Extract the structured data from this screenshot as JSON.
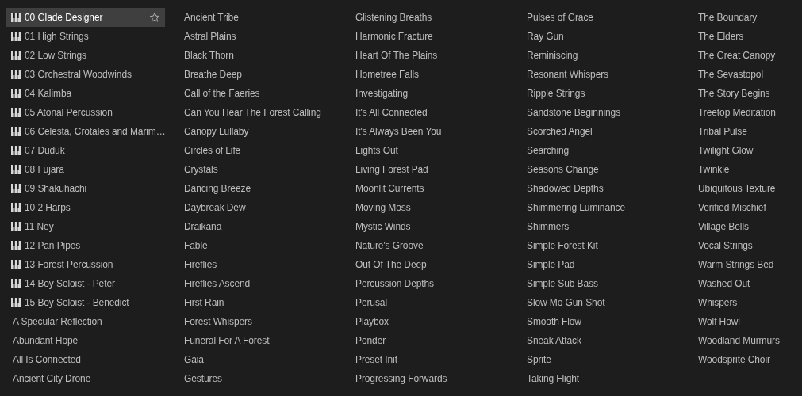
{
  "presets": [
    {
      "label": "00 Glade Designer",
      "kind": "instrument",
      "selected": true
    },
    {
      "label": "01 High Strings",
      "kind": "instrument",
      "selected": false
    },
    {
      "label": "02 Low Strings",
      "kind": "instrument",
      "selected": false
    },
    {
      "label": "03 Orchestral Woodwinds",
      "kind": "instrument",
      "selected": false
    },
    {
      "label": "04 Kalimba",
      "kind": "instrument",
      "selected": false
    },
    {
      "label": "05 Atonal Percussion",
      "kind": "instrument",
      "selected": false
    },
    {
      "label": "06 Celesta, Crotales and Marim…",
      "kind": "instrument",
      "selected": false
    },
    {
      "label": "07 Duduk",
      "kind": "instrument",
      "selected": false
    },
    {
      "label": "08 Fujara",
      "kind": "instrument",
      "selected": false
    },
    {
      "label": "09 Shakuhachi",
      "kind": "instrument",
      "selected": false
    },
    {
      "label": "10 2 Harps",
      "kind": "instrument",
      "selected": false
    },
    {
      "label": "11 Ney",
      "kind": "instrument",
      "selected": false
    },
    {
      "label": "12 Pan Pipes",
      "kind": "instrument",
      "selected": false
    },
    {
      "label": "13 Forest Percussion",
      "kind": "instrument",
      "selected": false
    },
    {
      "label": "14 Boy Soloist - Peter",
      "kind": "instrument",
      "selected": false
    },
    {
      "label": "15 Boy Soloist - Benedict",
      "kind": "instrument",
      "selected": false
    },
    {
      "label": "A Specular Reflection",
      "kind": "preset",
      "selected": false
    },
    {
      "label": "Abundant Hope",
      "kind": "preset",
      "selected": false
    },
    {
      "label": "All Is Connected",
      "kind": "preset",
      "selected": false
    },
    {
      "label": "Ancient City Drone",
      "kind": "preset",
      "selected": false
    },
    {
      "label": "Ancient Tribe",
      "kind": "preset",
      "selected": false
    },
    {
      "label": "Astral Plains",
      "kind": "preset",
      "selected": false
    },
    {
      "label": "Black Thorn",
      "kind": "preset",
      "selected": false
    },
    {
      "label": "Breathe Deep",
      "kind": "preset",
      "selected": false
    },
    {
      "label": "Call of the Faeries",
      "kind": "preset",
      "selected": false
    },
    {
      "label": "Can You Hear The Forest Calling",
      "kind": "preset",
      "selected": false
    },
    {
      "label": "Canopy Lullaby",
      "kind": "preset",
      "selected": false
    },
    {
      "label": "Circles of Life",
      "kind": "preset",
      "selected": false
    },
    {
      "label": "Crystals",
      "kind": "preset",
      "selected": false
    },
    {
      "label": "Dancing Breeze",
      "kind": "preset",
      "selected": false
    },
    {
      "label": "Daybreak Dew",
      "kind": "preset",
      "selected": false
    },
    {
      "label": "Draikana",
      "kind": "preset",
      "selected": false
    },
    {
      "label": "Fable",
      "kind": "preset",
      "selected": false
    },
    {
      "label": "Fireflies",
      "kind": "preset",
      "selected": false
    },
    {
      "label": "Fireflies Ascend",
      "kind": "preset",
      "selected": false
    },
    {
      "label": "First Rain",
      "kind": "preset",
      "selected": false
    },
    {
      "label": "Forest Whispers",
      "kind": "preset",
      "selected": false
    },
    {
      "label": "Funeral For A Forest",
      "kind": "preset",
      "selected": false
    },
    {
      "label": "Gaia",
      "kind": "preset",
      "selected": false
    },
    {
      "label": "Gestures",
      "kind": "preset",
      "selected": false
    },
    {
      "label": "Glistening Breaths",
      "kind": "preset",
      "selected": false
    },
    {
      "label": "Harmonic Fracture",
      "kind": "preset",
      "selected": false
    },
    {
      "label": "Heart Of The Plains",
      "kind": "preset",
      "selected": false
    },
    {
      "label": "Hometree Falls",
      "kind": "preset",
      "selected": false
    },
    {
      "label": "Investigating",
      "kind": "preset",
      "selected": false
    },
    {
      "label": "It's All Connected",
      "kind": "preset",
      "selected": false
    },
    {
      "label": "It's Always Been You",
      "kind": "preset",
      "selected": false
    },
    {
      "label": "Lights Out",
      "kind": "preset",
      "selected": false
    },
    {
      "label": "Living Forest Pad",
      "kind": "preset",
      "selected": false
    },
    {
      "label": "Moonlit Currents",
      "kind": "preset",
      "selected": false
    },
    {
      "label": "Moving Moss",
      "kind": "preset",
      "selected": false
    },
    {
      "label": "Mystic Winds",
      "kind": "preset",
      "selected": false
    },
    {
      "label": "Nature's Groove",
      "kind": "preset",
      "selected": false
    },
    {
      "label": "Out Of The Deep",
      "kind": "preset",
      "selected": false
    },
    {
      "label": "Percussion Depths",
      "kind": "preset",
      "selected": false
    },
    {
      "label": "Perusal",
      "kind": "preset",
      "selected": false
    },
    {
      "label": "Playbox",
      "kind": "preset",
      "selected": false
    },
    {
      "label": "Ponder",
      "kind": "preset",
      "selected": false
    },
    {
      "label": "Preset Init",
      "kind": "preset",
      "selected": false
    },
    {
      "label": "Progressing Forwards",
      "kind": "preset",
      "selected": false
    },
    {
      "label": "Pulses of Grace",
      "kind": "preset",
      "selected": false
    },
    {
      "label": "Ray Gun",
      "kind": "preset",
      "selected": false
    },
    {
      "label": "Reminiscing",
      "kind": "preset",
      "selected": false
    },
    {
      "label": "Resonant Whispers",
      "kind": "preset",
      "selected": false
    },
    {
      "label": "Ripple Strings",
      "kind": "preset",
      "selected": false
    },
    {
      "label": "Sandstone Beginnings",
      "kind": "preset",
      "selected": false
    },
    {
      "label": "Scorched Angel",
      "kind": "preset",
      "selected": false
    },
    {
      "label": "Searching",
      "kind": "preset",
      "selected": false
    },
    {
      "label": "Seasons Change",
      "kind": "preset",
      "selected": false
    },
    {
      "label": "Shadowed Depths",
      "kind": "preset",
      "selected": false
    },
    {
      "label": "Shimmering Luminance",
      "kind": "preset",
      "selected": false
    },
    {
      "label": "Shimmers",
      "kind": "preset",
      "selected": false
    },
    {
      "label": "Simple Forest Kit",
      "kind": "preset",
      "selected": false
    },
    {
      "label": "Simple Pad",
      "kind": "preset",
      "selected": false
    },
    {
      "label": "Simple Sub Bass",
      "kind": "preset",
      "selected": false
    },
    {
      "label": "Slow Mo Gun Shot",
      "kind": "preset",
      "selected": false
    },
    {
      "label": "Smooth Flow",
      "kind": "preset",
      "selected": false
    },
    {
      "label": "Sneak Attack",
      "kind": "preset",
      "selected": false
    },
    {
      "label": "Sprite",
      "kind": "preset",
      "selected": false
    },
    {
      "label": "Taking Flight",
      "kind": "preset",
      "selected": false
    },
    {
      "label": "The Boundary",
      "kind": "preset",
      "selected": false
    },
    {
      "label": "The Elders",
      "kind": "preset",
      "selected": false
    },
    {
      "label": "The Great Canopy",
      "kind": "preset",
      "selected": false
    },
    {
      "label": "The Sevastopol",
      "kind": "preset",
      "selected": false
    },
    {
      "label": "The Story Begins",
      "kind": "preset",
      "selected": false
    },
    {
      "label": "Treetop Meditation",
      "kind": "preset",
      "selected": false
    },
    {
      "label": "Tribal Pulse",
      "kind": "preset",
      "selected": false
    },
    {
      "label": "Twilight Glow",
      "kind": "preset",
      "selected": false
    },
    {
      "label": "Twinkle",
      "kind": "preset",
      "selected": false
    },
    {
      "label": "Ubiquitous Texture",
      "kind": "preset",
      "selected": false
    },
    {
      "label": "Verified Mischief",
      "kind": "preset",
      "selected": false
    },
    {
      "label": "Village Bells",
      "kind": "preset",
      "selected": false
    },
    {
      "label": "Vocal Strings",
      "kind": "preset",
      "selected": false
    },
    {
      "label": "Warm Strings Bed",
      "kind": "preset",
      "selected": false
    },
    {
      "label": "Washed Out",
      "kind": "preset",
      "selected": false
    },
    {
      "label": "Whispers",
      "kind": "preset",
      "selected": false
    },
    {
      "label": "Wolf Howl",
      "kind": "preset",
      "selected": false
    },
    {
      "label": "Woodland Murmurs",
      "kind": "preset",
      "selected": false
    },
    {
      "label": "Woodsprite Choir",
      "kind": "preset",
      "selected": false
    }
  ]
}
